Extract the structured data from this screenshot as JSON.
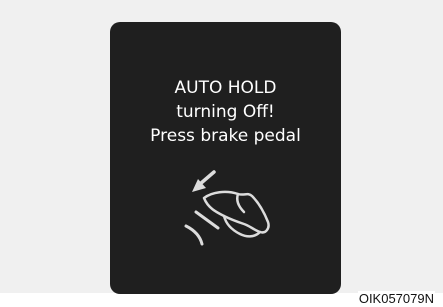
{
  "display": {
    "message_lines": [
      "AUTO HOLD",
      "turning Off!",
      "Press brake pedal"
    ],
    "icon": "press-brake-pedal-icon"
  },
  "figure_code": "OIK057079N",
  "colors": {
    "screen": "#1f1f1f",
    "text": "#ffffff",
    "frame": "#f0f0f0",
    "icon_stroke": "#dcdcdc"
  }
}
